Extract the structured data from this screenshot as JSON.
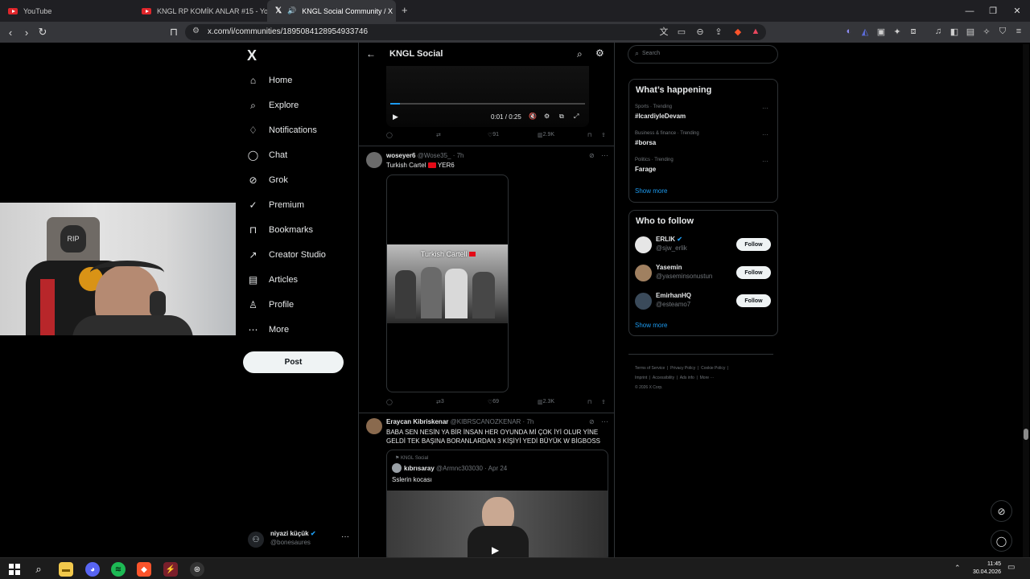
{
  "browser": {
    "tabs": [
      {
        "title": "YouTube",
        "active": false
      },
      {
        "title": "KNGL RP KOMİK ANLAR #15 - YouTu",
        "active": false
      },
      {
        "title": "KNGL Social Community / X",
        "active": true
      }
    ],
    "new_tab": "+",
    "window_controls": [
      "—",
      "❐",
      "✕"
    ],
    "url": "x.com/i/communities/1895084128954933746"
  },
  "sidebar": {
    "logo": "X",
    "items": [
      {
        "label": "Home",
        "icon": "home-icon",
        "glyph": "⌂"
      },
      {
        "label": "Explore",
        "icon": "search-icon",
        "glyph": "⌕"
      },
      {
        "label": "Notifications",
        "icon": "bell-icon",
        "glyph": "♢"
      },
      {
        "label": "Chat",
        "icon": "chat-icon",
        "glyph": "◯"
      },
      {
        "label": "Grok",
        "icon": "grok-icon",
        "glyph": "⊘"
      },
      {
        "label": "Premium",
        "icon": "premium-icon",
        "glyph": "✓"
      },
      {
        "label": "Bookmarks",
        "icon": "bookmark-icon",
        "glyph": "⊓"
      },
      {
        "label": "Creator Studio",
        "icon": "creator-studio-icon",
        "glyph": "↗"
      },
      {
        "label": "Articles",
        "icon": "articles-icon",
        "glyph": "▤"
      },
      {
        "label": "Profile",
        "icon": "profile-icon",
        "glyph": "♙"
      },
      {
        "label": "More",
        "icon": "more-icon",
        "glyph": "⋯"
      }
    ],
    "post_label": "Post",
    "account": {
      "name": "niyazi küçük",
      "handle": "@bonesaures",
      "menu": "···"
    }
  },
  "header": {
    "title": "KNGL Social",
    "back": "←"
  },
  "tweets": [
    {
      "video_time": "0:01 / 0:25",
      "video_progress": 0.05,
      "replies": "",
      "reposts": "",
      "likes": "91",
      "views": "2.9K"
    },
    {
      "name": "woseyer6",
      "handle": "@Wose35_",
      "time": "· 7h",
      "text_before": "Turkish Cartel",
      "text_after": "YER6",
      "media_caption": "Turkish Cartell",
      "replies": "",
      "reposts": "3",
      "likes": "69",
      "views": "2.3K"
    },
    {
      "name": "Eraycan Kibriskenar",
      "handle": "@KIBRSCANOZKENAR",
      "time": "· 7h",
      "text": "BABA SEN NESİN YA BİR İNSAN HER OYUNDA Mİ ÇOK İYİ OLUR YİNE GELDİ TEK BAŞINA BORANLARDAN 3 KİŞİYİ YEDİ BÜYÜK W BİGBOSS",
      "quote": {
        "community": "KNGL Social",
        "name": "kıbrısaray",
        "handle": "@Armnc303030",
        "time": "· Apr 24",
        "text": "Sslerin kocası"
      }
    }
  ],
  "right": {
    "search_placeholder": "Search",
    "happening_title": "What’s happening",
    "trends": [
      {
        "meta": "Sports · Trending",
        "name": "#IcardiyleDevam"
      },
      {
        "meta": "Business & finance · Trending",
        "name": "#borsa"
      },
      {
        "meta": "Politics · Trending",
        "name": "Farage"
      }
    ],
    "show_more": "Show more",
    "follow_title": "Who to follow",
    "follow": [
      {
        "name": "ERLIK",
        "handle": "@sjw_erlik",
        "verified": true
      },
      {
        "name": "Yasemin",
        "handle": "@yaseminsonustun",
        "verified": false
      },
      {
        "name": "EmirhanHQ",
        "handle": "@esteamo7",
        "verified": false
      }
    ],
    "follow_label": "Follow",
    "footer": [
      "Terms of Service",
      "Privacy Policy",
      "Cookie Policy",
      "Imprint",
      "Accessibility",
      "Ads info",
      "More ···",
      "© 2026 X Corp."
    ]
  },
  "taskbar": {
    "time": "11:45",
    "date": "30.04.2026"
  },
  "colors": {
    "accent": "#1d9bf0",
    "bg": "#000000",
    "border": "#2f3336",
    "muted": "#71767b"
  }
}
